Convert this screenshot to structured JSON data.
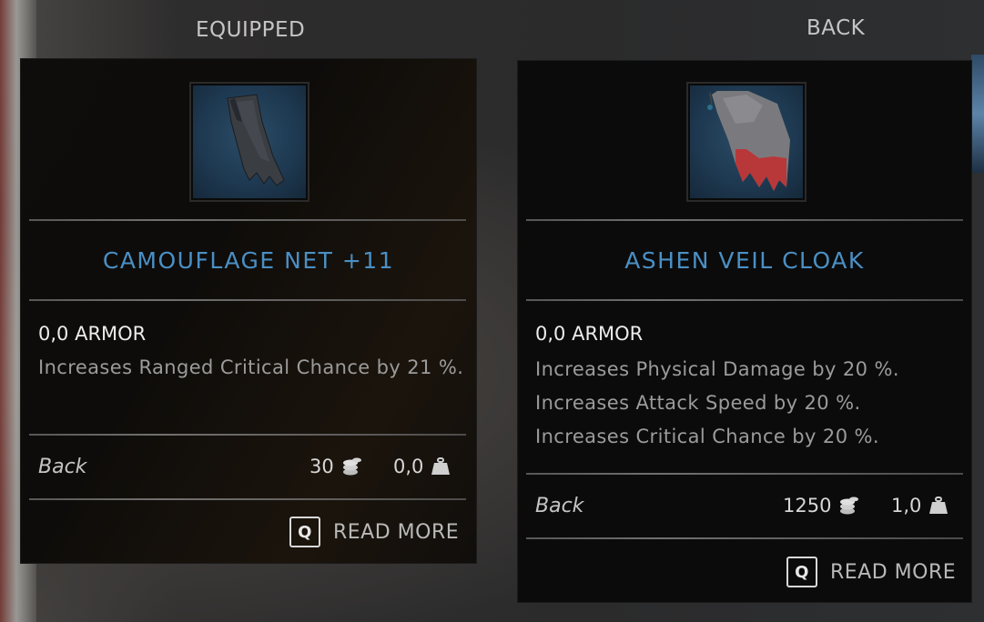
{
  "labels": {
    "equipped": "EQUIPPED",
    "back": "BACK"
  },
  "equipped_item": {
    "name": "CAMOUFLAGE NET +11",
    "armor": "0,0 ARMOR",
    "effects": [
      "Increases Ranged Critical Chance by 21 %."
    ],
    "slot": "Back",
    "value": "30",
    "weight": "0,0",
    "read_more_key": "Q",
    "read_more_label": "READ MORE",
    "icon": "dark-net-cloak"
  },
  "compare_item": {
    "name": "ASHEN VEIL CLOAK",
    "armor": "0,0 ARMOR",
    "effects": [
      "Increases Physical Damage by 20 %.",
      "Increases Attack Speed by 20 %.",
      "Increases Critical Chance by 20 %."
    ],
    "slot": "Back",
    "value": "1250",
    "weight": "1,0",
    "read_more_key": "Q",
    "read_more_label": "READ MORE",
    "icon": "grey-red-cloak"
  },
  "colors": {
    "title": "#4a8fc4",
    "panel": "#0d0c0b",
    "text": "#ececec",
    "muted": "#9b9b9b"
  },
  "icons": {
    "coin": "coin-stack-icon",
    "weight": "weight-icon"
  }
}
